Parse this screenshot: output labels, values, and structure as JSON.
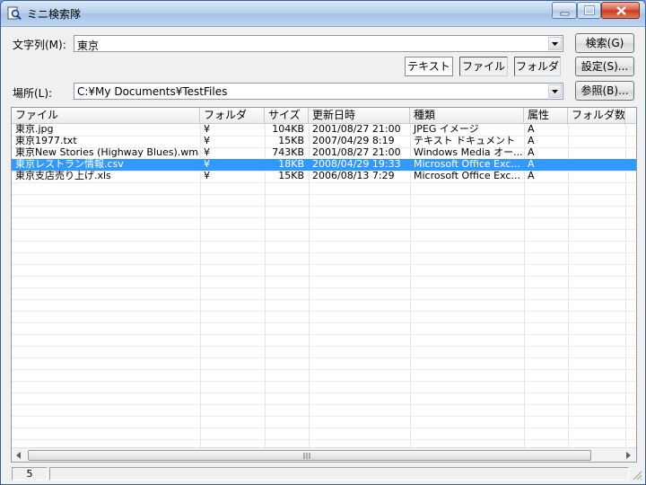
{
  "window": {
    "title": "ミニ検索隊"
  },
  "search": {
    "string_label": "文字列(M):",
    "string_value": "東京",
    "place_label": "場所(L):",
    "place_value": "C:¥My Documents¥TestFiles"
  },
  "buttons": {
    "search": "検索(G)",
    "settings": "設定(S)...",
    "browse": "参照(B)..."
  },
  "toggles": {
    "text": "テキスト",
    "file": "ファイル",
    "folder": "フォルダ"
  },
  "columns": [
    "ファイル",
    "フォルダ",
    "サイズ",
    "更新日時",
    "種類",
    "属性",
    "フォルダ数"
  ],
  "rows": [
    {
      "name": "東京.jpg",
      "folder": "¥",
      "size": "104KB",
      "modified": "2001/08/27 21:00",
      "type": "JPEG イメージ",
      "attr": "A"
    },
    {
      "name": "東京1977.txt",
      "folder": "¥",
      "size": "15KB",
      "modified": "2007/04/29 8:19",
      "type": "テキスト ドキュメント",
      "attr": "A"
    },
    {
      "name": "東京New Stories (Highway Blues).wma",
      "folder": "¥",
      "size": "743KB",
      "modified": "2001/08/27 21:00",
      "type": "Windows Media オー...",
      "attr": "A"
    },
    {
      "name": "東京レストラン情報.csv",
      "folder": "¥",
      "size": "18KB",
      "modified": "2008/04/29 19:33",
      "type": "Microsoft Office Exc...",
      "attr": "A"
    },
    {
      "name": "東京支店売り上げ.xls",
      "folder": "¥",
      "size": "15KB",
      "modified": "2006/08/13 7:29",
      "type": "Microsoft Office Exc...",
      "attr": "A"
    }
  ],
  "status": {
    "count": "5"
  }
}
